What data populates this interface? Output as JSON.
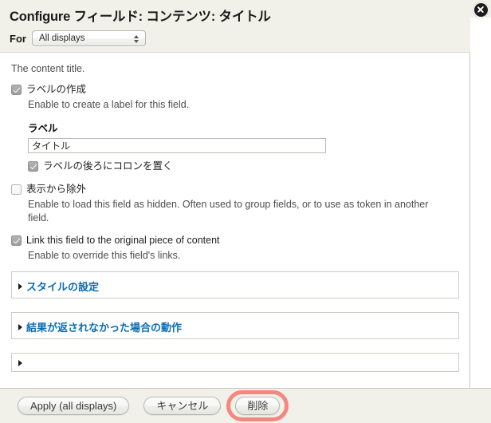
{
  "dialog": {
    "title": "Configure フィールド: コンテンツ: タイトル",
    "close_icon": "close-circle-icon",
    "for_label": "For",
    "for_select": {
      "value": "All displays",
      "icon": "updown-arrows-icon"
    }
  },
  "body": {
    "content_description": "The content title.",
    "create_label": {
      "label": "ラベルの作成",
      "checked": true,
      "description": "Enable to create a label for this field."
    },
    "label_heading": "ラベル",
    "label_input": {
      "value": "タイトル",
      "placeholder": ""
    },
    "colon_after_label": {
      "label": "ラベルの後ろにコロンを置く",
      "checked": true
    },
    "exclude_from_display": {
      "label": "表示から除外",
      "checked": false,
      "description": "Enable to load this field as hidden. Often used to group fields, or to use as token in another field."
    },
    "link_original": {
      "label": "Link this field to the original piece of content",
      "checked": true,
      "description": "Enable to override this field's links."
    },
    "fieldsets": [
      {
        "legend": "スタイルの設定",
        "triangle_icon": "triangle-right-icon",
        "expanded": false
      },
      {
        "legend": "結果が返されなかった場合の動作",
        "triangle_icon": "triangle-right-icon",
        "expanded": false
      },
      {
        "legend": "",
        "triangle_icon": "triangle-right-icon",
        "expanded": false
      }
    ]
  },
  "footer": {
    "apply_label": "Apply (all displays)",
    "cancel_label": "キャンセル",
    "delete_label": "削除",
    "highlight_color": "#f4877f"
  }
}
